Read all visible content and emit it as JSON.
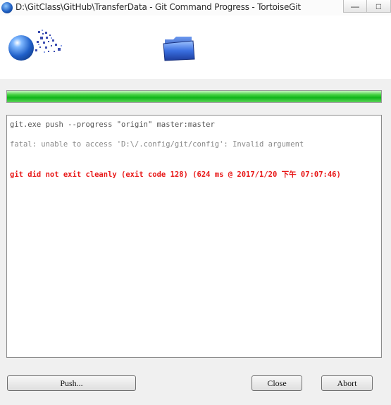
{
  "window": {
    "title": "D:\\GitClass\\GitHub\\TransferData - Git Command Progress - TortoiseGit",
    "minimize_glyph": "—",
    "maximize_glyph": "□",
    "close_glyph": "✕"
  },
  "header": {
    "left_icon": "globe-network-icon",
    "right_icon": "folder-icon"
  },
  "progress": {
    "percent": 100,
    "color": "#11b51a"
  },
  "log": {
    "command_line": "git.exe push --progress \"origin\" master:master",
    "fatal_line": "fatal: unable to access 'D:\\/.config/git/config': Invalid argument",
    "error_line": "git did not exit cleanly (exit code 128) (624 ms @ 2017/1/20 下午 07:07:46)",
    "error_color": "#e81818"
  },
  "buttons": {
    "push": "Push...",
    "close": "Close",
    "abort": "Abort"
  }
}
